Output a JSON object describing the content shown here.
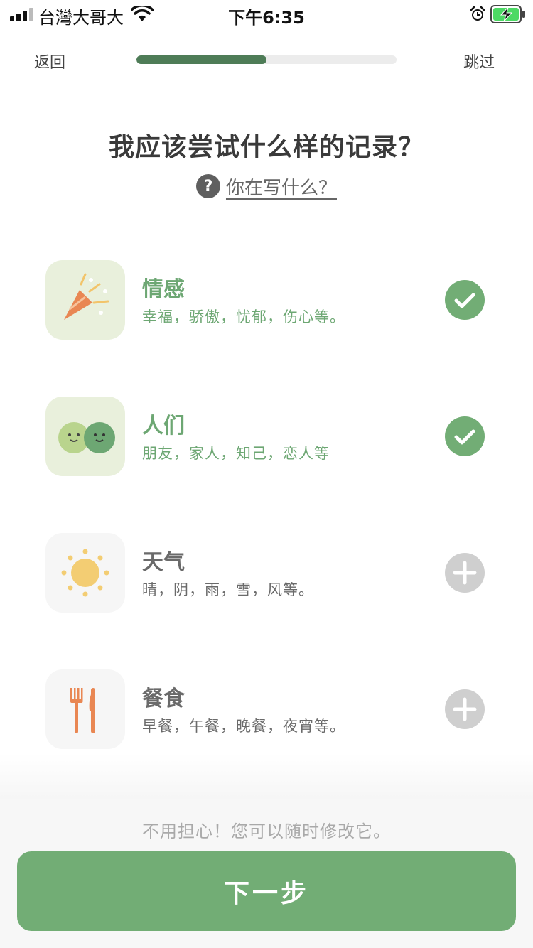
{
  "status_bar": {
    "carrier": "台灣大哥大",
    "time": "下午6:35"
  },
  "nav": {
    "back_label": "返回",
    "skip_label": "跳过",
    "progress_fraction": 0.5
  },
  "header": {
    "title": "我应该尝试什么样的记录？",
    "help_icon": "?",
    "help_text": "你在写什么？"
  },
  "categories": [
    {
      "title": "情感",
      "description": "幸福，骄傲，忧郁，伤心等。",
      "icon": "party-popper-icon",
      "selected": true
    },
    {
      "title": "人们",
      "description": "朋友，家人，知己，恋人等",
      "icon": "two-faces-icon",
      "selected": true
    },
    {
      "title": "天气",
      "description": "晴，阴，雨，雪，风等。",
      "icon": "sun-icon",
      "selected": false
    },
    {
      "title": "餐食",
      "description": "早餐，午餐，晚餐，夜宵等。",
      "icon": "fork-knife-icon",
      "selected": false
    }
  ],
  "footer": {
    "reassure_text": "不用担心！您可以随时修改它。",
    "next_label": "下一步"
  },
  "colors": {
    "accent_green": "#72ad75",
    "selected_text": "#6da773",
    "progress_fill": "#4e7c57",
    "unselected_gray": "#cfcfcf"
  }
}
